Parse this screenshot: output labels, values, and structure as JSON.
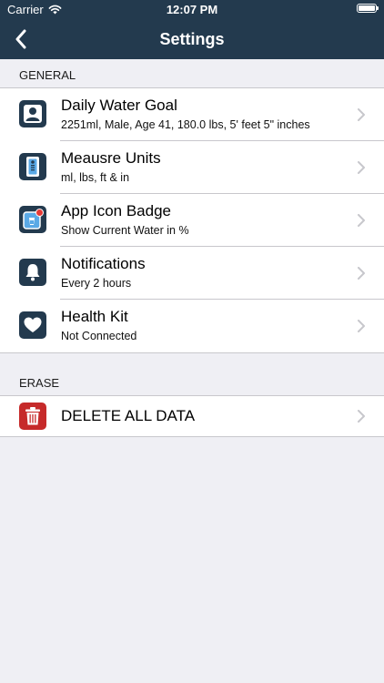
{
  "status": {
    "carrier": "Carrier",
    "time": "12:07 PM"
  },
  "nav": {
    "title": "Settings"
  },
  "sections": {
    "general": "GENERAL",
    "erase": "ERASE"
  },
  "general_rows": [
    {
      "title": "Daily Water Goal",
      "subtitle": "2251ml, Male, Age 41, 180.0 lbs, 5' feet 5\" inches",
      "icon": "person-icon"
    },
    {
      "title": "Meausre Units",
      "subtitle": "ml, lbs, ft & in",
      "icon": "measure-icon"
    },
    {
      "title": "App Icon Badge",
      "subtitle": "Show Current Water in %",
      "icon": "badge-icon"
    },
    {
      "title": "Notifications",
      "subtitle": "Every 2 hours",
      "icon": "bell-icon"
    },
    {
      "title": "Health Kit",
      "subtitle": "Not Connected",
      "icon": "heart-icon"
    }
  ],
  "erase_rows": [
    {
      "title": "DELETE ALL DATA",
      "icon": "trash-icon"
    }
  ],
  "colors": {
    "nav_bg": "#233a4e",
    "icon_bg": "#233a4e",
    "delete_bg": "#c62a2a",
    "page_bg": "#efeff4"
  }
}
